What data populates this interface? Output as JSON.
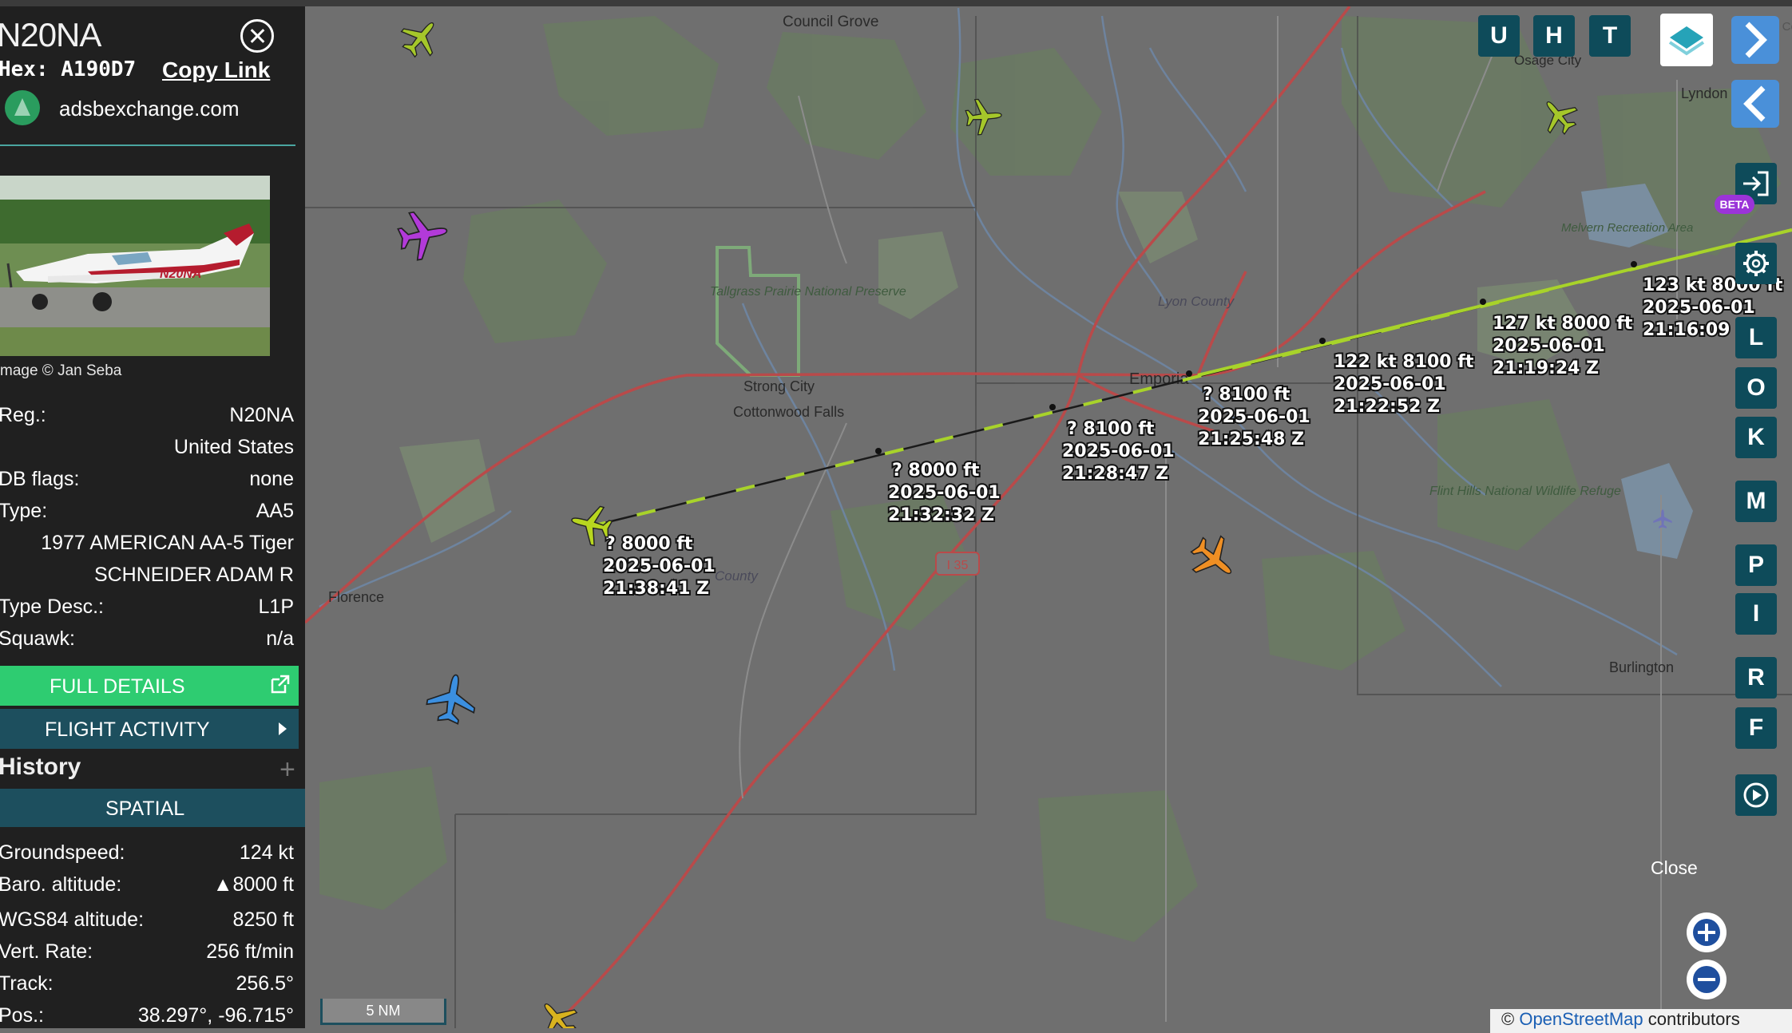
{
  "aircraft": {
    "registration_title": "N20NA",
    "hex_label": "Hex:",
    "hex_value": "A190D7",
    "copy_link": "Copy Link",
    "source": "adsbexchange.com",
    "photo_tail_text": "N20NA",
    "photo_credit": "mage © Jan Seba"
  },
  "details": [
    {
      "key": "Reg.:",
      "value": "N20NA"
    },
    {
      "key": "",
      "value": "United States"
    },
    {
      "key": "DB flags:",
      "value": "none"
    },
    {
      "key": "Type:",
      "value": "AA5"
    },
    {
      "key": "",
      "value": "1977 AMERICAN AA-5 Tiger"
    },
    {
      "key": "",
      "value": "SCHNEIDER ADAM R"
    },
    {
      "key": "Type Desc.:",
      "value": "L1P"
    },
    {
      "key": "Squawk:",
      "value": "n/a"
    }
  ],
  "buttons": {
    "full_details": "FULL DETAILS",
    "flight_activity": "FLIGHT ACTIVITY",
    "history": "History",
    "history_toggle": "+",
    "spatial": "SPATIAL"
  },
  "spatial": [
    {
      "key": "Groundspeed:",
      "value": "124 kt"
    },
    {
      "key": "Baro. altitude:",
      "value": "▲8000 ft"
    },
    {
      "key": "WGS84 altitude:",
      "value": "8250 ft"
    },
    {
      "key": "Vert. Rate:",
      "value": "256 ft/min"
    },
    {
      "key": "Track:",
      "value": "256.5°"
    },
    {
      "key": "Pos.:",
      "value": "38.297°, -96.715°"
    }
  ],
  "map": {
    "places": [
      "Council Grove",
      "Osage City",
      "Lyndon",
      "Melvern Recreation Area",
      "Tallgrass Prairie National Preserve",
      "Lyon County",
      "Emporia",
      "Strong City",
      "Cottonwood Falls",
      "Flint Hills National Wildlife Refuge",
      "Florence",
      "Burlington",
      "County",
      "Osa Cou"
    ],
    "highway": "I 35",
    "track_labels": [
      {
        "l1": "?  8000 ft",
        "l2": "2025-06-01",
        "l3": "21:38:41 Z"
      },
      {
        "l1": "?  8000 ft",
        "l2": "2025-06-01",
        "l3": "21:32:32 Z"
      },
      {
        "l1": "?  8100 ft",
        "l2": "2025-06-01",
        "l3": "21:28:47 Z"
      },
      {
        "l1": "?  8100 ft",
        "l2": "2025-06-01",
        "l3": "21:25:48 Z"
      },
      {
        "l1": "122 kt  8100 ft",
        "l2": "2025-06-01",
        "l3": "21:22:52 Z"
      },
      {
        "l1": "127 kt  8000 ft",
        "l2": "2025-06-01",
        "l3": "21:19:24 Z"
      },
      {
        "l1": "123 kt  8000 ft",
        "l2": "2025-06-01",
        "l3": "21:16:09"
      }
    ],
    "scale": "5 NM",
    "close": "Close",
    "attribution_prefix": "© ",
    "attribution_link": "OpenStreetMap",
    "attribution_suffix": " contributors"
  },
  "controls": {
    "top": [
      "U",
      "H",
      "T"
    ],
    "side": [
      "L",
      "O",
      "K",
      "M",
      "P",
      "I",
      "R",
      "F"
    ],
    "beta": "BETA"
  },
  "colors": {
    "accent_teal": "#1d4f5e",
    "green_button": "#2ecc71",
    "track_line": "#a8d32a"
  }
}
